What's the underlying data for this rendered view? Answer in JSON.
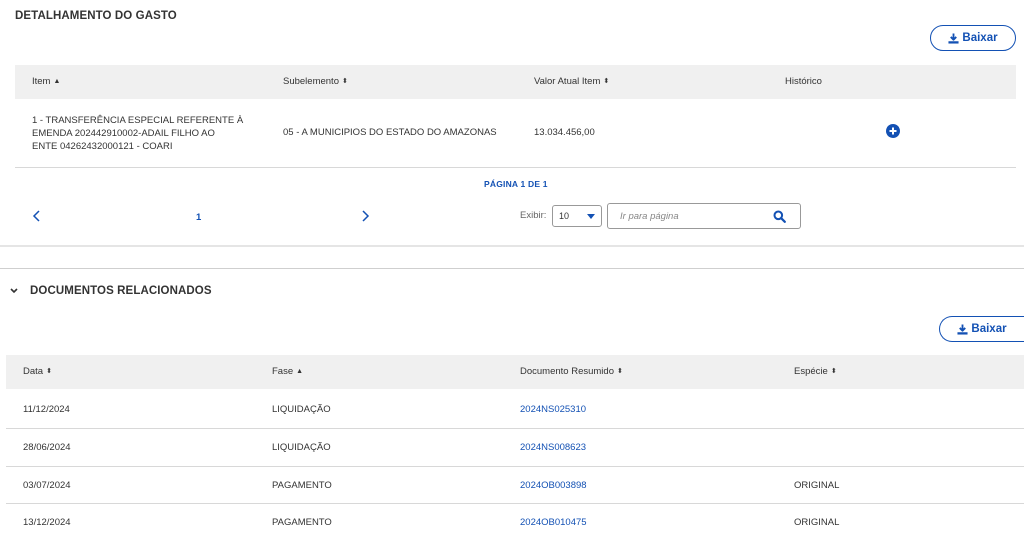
{
  "gasto": {
    "title": "DETALHAMENTO DO GASTO",
    "download_label": "Baixar",
    "columns": [
      "Item",
      "Subelemento",
      "Valor Atual Item",
      "Histórico"
    ],
    "row": {
      "item_lines": [
        "1 - TRANSFERÊNCIA ESPECIAL REFERENTE À",
        "EMENDA 202442910002-ADAIL FILHO AO",
        "ENTE 04262432000121 - COARI"
      ],
      "subelemento": "05 - A MUNICIPIOS DO ESTADO DO AMAZONAS",
      "valor": "13.034.456,00"
    },
    "pager": {
      "label": "PÁGINA 1 DE 1",
      "current_page": "1",
      "exibir_label": "Exibir:",
      "page_size": "10",
      "goto_placeholder": "Ir para página"
    }
  },
  "documentos": {
    "title": "DOCUMENTOS RELACIONADOS",
    "download_label": "Baixar",
    "columns": [
      "Data",
      "Fase",
      "Documento Resumido",
      "Espécie"
    ],
    "rows": [
      {
        "data": "11/12/2024",
        "fase": "LIQUIDAÇÃO",
        "documento": "2024NS025310",
        "especie": ""
      },
      {
        "data": "28/06/2024",
        "fase": "LIQUIDAÇÃO",
        "documento": "2024NS008623",
        "especie": ""
      },
      {
        "data": "03/07/2024",
        "fase": "PAGAMENTO",
        "documento": "2024OB003898",
        "especie": "ORIGINAL"
      },
      {
        "data": "13/12/2024",
        "fase": "PAGAMENTO",
        "documento": "2024OB010475",
        "especie": "ORIGINAL"
      }
    ]
  },
  "icons": {
    "download": "download-icon",
    "sort": "sort-icon",
    "plus_circle": "plus-circle-icon",
    "chevron_left": "chevron-left-icon",
    "chevron_right": "chevron-right-icon",
    "search": "search-icon",
    "chevron_down": "chevron-down-icon"
  },
  "colors": {
    "accent": "#1351b4",
    "header_bg": "#f0f0f0",
    "divider": "#d8d8d8"
  }
}
